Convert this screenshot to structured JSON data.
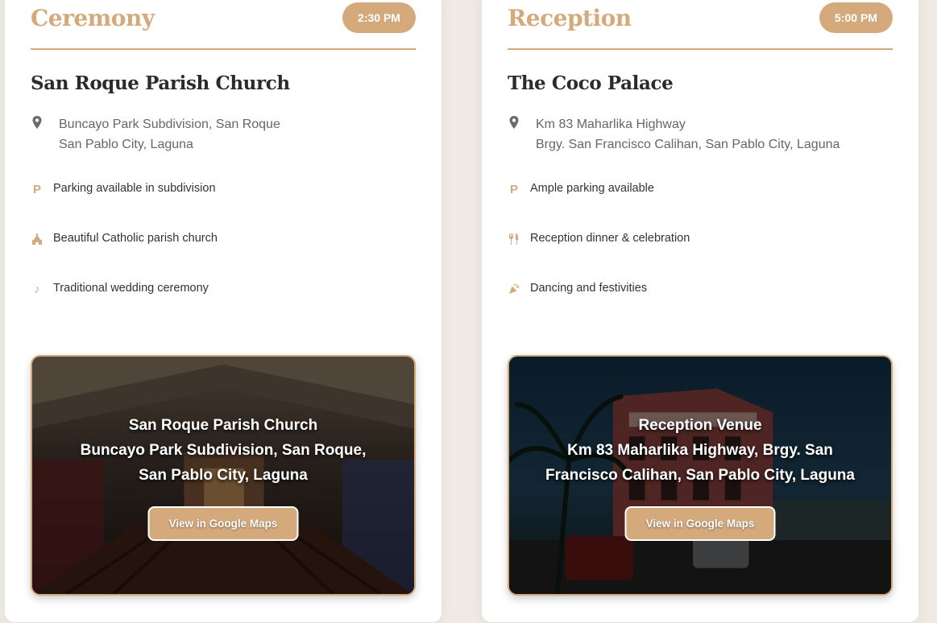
{
  "ceremony": {
    "title": "Ceremony",
    "time": "2:30 PM",
    "venue_name": "San Roque Parish Church",
    "address_lines": [
      "Buncayo Park Subdivision, San Roque",
      "San Pablo City, Laguna"
    ],
    "features": [
      {
        "icon": "parking-icon",
        "label": "Parking available in subdivision"
      },
      {
        "icon": "church-icon",
        "label": "Beautiful Catholic parish church"
      },
      {
        "icon": "music-note-icon",
        "label": "Traditional wedding ceremony"
      }
    ],
    "map": {
      "lines": [
        "San Roque Parish Church",
        "Buncayo Park Subdivision, San Roque,",
        "San Pablo City, Laguna"
      ],
      "button_label": "View in Google Maps"
    }
  },
  "reception": {
    "title": "Reception",
    "time": "5:00 PM",
    "venue_name": "The Coco Palace",
    "address_lines": [
      "Km 83 Maharlika Highway",
      "Brgy. San Francisco Calihan, San Pablo City, Laguna"
    ],
    "features": [
      {
        "icon": "parking-icon",
        "label": "Ample parking available"
      },
      {
        "icon": "utensils-icon",
        "label": "Reception dinner & celebration"
      },
      {
        "icon": "party-popper-icon",
        "label": "Dancing and festivities"
      }
    ],
    "map": {
      "lines": [
        "Reception Venue",
        "Km 83 Maharlika Highway, Brgy. San",
        "Francisco Calihan, San Pablo City, Laguna"
      ],
      "button_label": "View in Google Maps"
    }
  },
  "colors": {
    "accent": "#d4aa7d",
    "heading": "#2b2b2b",
    "body_text": "#666666",
    "page_background": "#efebe4"
  }
}
